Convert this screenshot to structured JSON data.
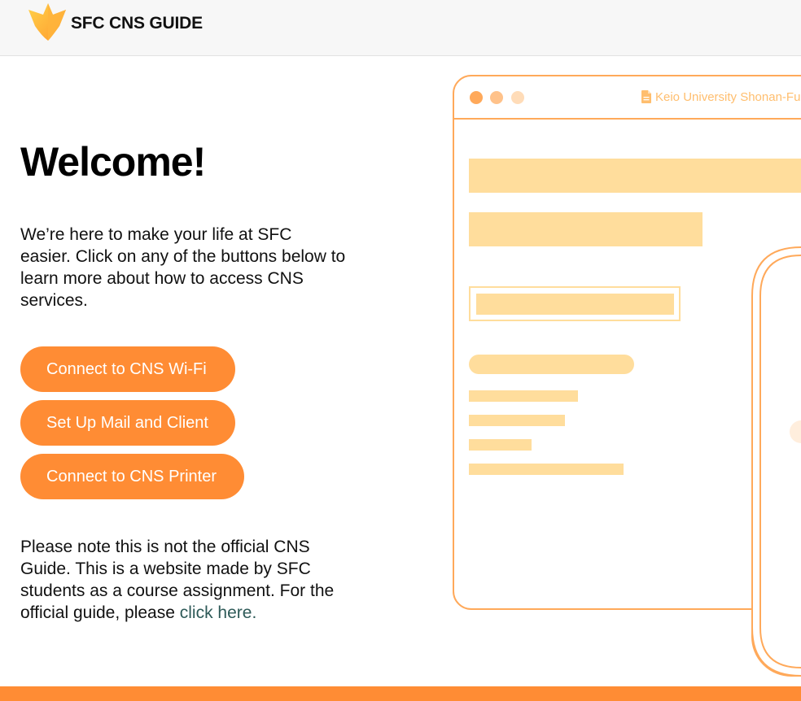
{
  "header": {
    "title": "SFC CNS GUIDE",
    "logo_icon": "shield-flame-logo-icon"
  },
  "hero": {
    "heading": "Welcome!",
    "intro": "We’re here to make your life at SFC easier. Click on any of the buttons below to learn more about how to access CNS services."
  },
  "buttons": {
    "wifi": "Connect to CNS Wi-Fi",
    "mail": "Set Up Mail and Client",
    "printer": "Connect to CNS Printer"
  },
  "note": {
    "text": "Please note this is not the official CNS Guide. This is a website made by SFC students as a course assignment. For the official guide, please ",
    "link_text": "click here."
  },
  "illustration": {
    "url_text": "Keio University Shonan-Fu",
    "url_icon": "document-icon"
  },
  "colors": {
    "accent": "#ff8c34",
    "illustration_stroke": "#ffa95a",
    "illustration_fill": "#ffdd9c",
    "link": "#2e5a58"
  }
}
